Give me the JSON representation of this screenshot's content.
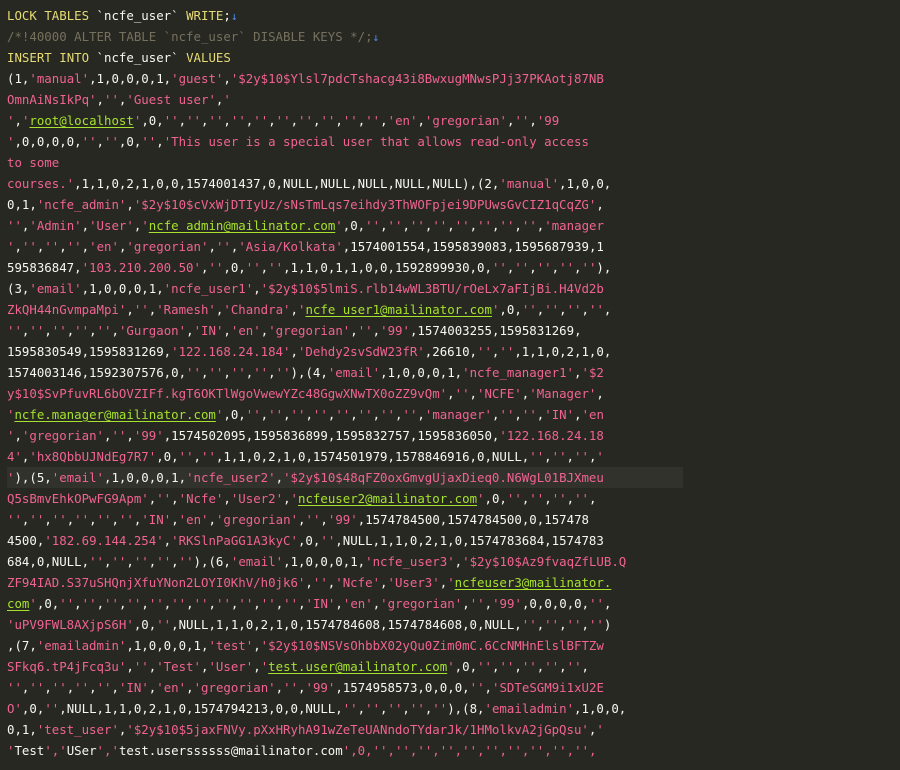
{
  "editor": {
    "lines": [
      "LOCK TABLES `ncfe_user` WRITE;",
      "/*!40000 ALTER TABLE `ncfe_user` DISABLE KEYS */;",
      "INSERT INTO `ncfe_user` VALUES",
      "(1,'manual',1,0,0,0,1,'guest','$2y$10$Ylsl7pdcTshacg43i8BwxugMNwsPJj37PKAotj87NB",
      "OmnAiNsIkPq','','Guest user','",
      "','root@localhost',0,'','','','','','','','','','','en','gregorian','','99",
      "',0,0,0,0,'','',0,'','This user is a special user that allows read-only access",
      "to some",
      "courses.',1,1,0,2,1,0,0,1574001437,0,NULL,NULL,NULL,NULL,NULL),(2,'manual',1,0,0,",
      "0,1,'ncfe_admin','$2y$10$cVxWjDTIyUz/sNsTmLqs7eihdy3ThWOFpjei9DPUwsGvCIZ1qCqZG',",
      "'','Admin','User','ncfe_admin@mailinator.com',0,'','','','','','','','','manager",
      "','','','','en','gregorian','','Asia/Kolkata',1574001554,1595839083,1595687939,1",
      "595836847,'103.210.200.50','',0,'','',1,1,0,1,1,0,0,1592899930,0,'','','','',''),",
      "(3,'email',1,0,0,0,1,'ncfe_user1','$2y$10$5lmiS.rlb14wWL3BTU/rOeLx7aFIjBi.H4Vd2b",
      "ZkQH44nGvmpaMpi','','Ramesh','Chandra','ncfe_user1@mailinator.com',0,'','','','',",
      "'','','','','','Gurgaon','IN','en','gregorian','','99',1574003255,1595831269,",
      "1595830549,1595831269,'122.168.24.184','Dehdy2svSdW23fR',26610,'','',1,1,0,2,1,0,",
      "1574003146,1592307576,0,'','','','',''),(4,'email',1,0,0,0,1,'ncfe_manager1','$2",
      "y$10$SvPfuvRL6bOVZIFf.kgT6OKTlWgoVwewYZc48GgwXNwTX0oZZ9vQm','','NCFE','Manager',",
      "'ncfe.manager@mailinator.com',0,'','','','','','','','','manager','','','IN','en",
      "','gregorian','','99',1574502095,1595836899,1595832757,1595836050,'122.168.24.18",
      "4','hx8QbbUJNdEg7R7',0,'','',1,1,0,2,1,0,1574501979,1578846916,0,NULL,'','','','",
      "'),(5,'email',1,0,0,0,1,'ncfe_user2','$2y$10$48qFZ0oxGmvgUjaxDieq0.N6WgL01BJXmeu",
      "Q5sBmvEhkOPwFG9Apm','','Ncfe','User2','ncfeuser2@mailinator.com',0,'','','','',",
      "'','','','','','','IN','en','gregorian','','99',1574784500,1574784500,0,157478",
      "4500,'182.69.144.254','RKSlnPaGG1A3kyC',0,'',NULL,1,1,0,2,1,0,1574783684,1574783",
      "684,0,NULL,'','','','',''),(6,'email',1,0,0,0,1,'ncfe_user3','$2y$10$Az9fvaqZfLUB.Q",
      "ZF94IAD.S37uSHQnjXfuYNon2LOYI0KhV/h0jk6','','Ncfe','User3','ncfeuser3@mailinator.",
      "com',0,'','','','','','','','','','','','IN','en','gregorian','','99',0,0,0,0,'',",
      "'uPV9FWL8AXjpS6H',0,'',NULL,1,1,0,2,1,0,1574784608,1574784608,0,NULL,'','','','')",
      ",(7,'emailadmin',1,0,0,0,1,'test','$2y$10$NSVsOhbbX02yQu0Zim0mC.6CcNMHnElslBFTZw",
      "SFkq6.tP4jFcq3u','','Test','User','test.user@mailinator.com',0,'','','','','',",
      "'','','','','','IN','en','gregorian','','99',1574958573,0,0,0,'','SDTeSGM9i1xU2E",
      "O',0,'',NULL,1,1,0,2,1,0,1574794213,0,0,NULL,'','','','',''),(8,'emailadmin',1,0,0,",
      "0,1,'test_user','$2y$10$5jaxFNVy.pXxHRyhA91wZeTeUANndoTYdarJk/1HMolkvA2jGpQsu','",
      "'Test','USer','test.userssssss@mailinator.com',0,'','','','','','','','','','',"
    ],
    "active_line_index": 22
  },
  "colors": {
    "background": "#272822",
    "keyword": "#e6db74",
    "string": "#f06392",
    "email": "#a6e22e",
    "comment": "#75715e",
    "whitespace_marker": "#3b7bd1"
  }
}
